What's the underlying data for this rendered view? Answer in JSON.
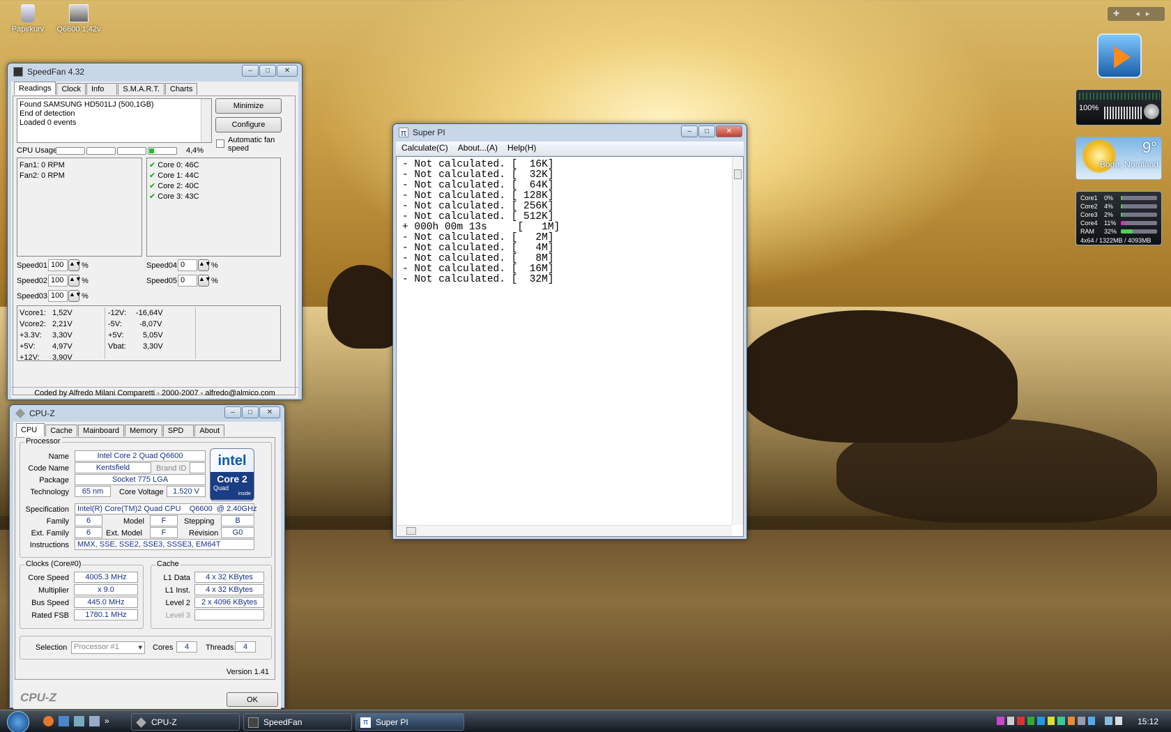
{
  "desktop": {
    "icons": [
      {
        "label": "Papirkurv"
      },
      {
        "label": "Q6600 1,42v"
      }
    ]
  },
  "speedfan": {
    "title": "SpeedFan 4.32",
    "tabs": [
      "Readings",
      "Clock",
      "Info",
      "S.M.A.R.T.",
      "Charts"
    ],
    "log": [
      "Found SAMSUNG HD501LJ (500,1GB)",
      "End of detection",
      "Loaded 0 events"
    ],
    "buttons": {
      "minimize": "Minimize",
      "configure": "Configure"
    },
    "auto_fan": "Automatic fan speed",
    "cpu_usage_label": "CPU Usage",
    "cpu_usage_value": "4,4%",
    "cpu_usage_fraction": 0.044,
    "fans": [
      "Fan1: 0 RPM",
      "Fan2: 0 RPM"
    ],
    "temps": [
      "Core 0: 46C",
      "Core 1: 44C",
      "Core 2: 40C",
      "Core 3: 43C"
    ],
    "speeds": [
      {
        "label": "Speed01:",
        "value": "100"
      },
      {
        "label": "Speed02:",
        "value": "100"
      },
      {
        "label": "Speed03:",
        "value": "100"
      },
      {
        "label": "Speed04:",
        "value": "0"
      },
      {
        "label": "Speed05:",
        "value": "0"
      }
    ],
    "pct": "%",
    "volts": [
      {
        "l": "Vcore1:",
        "v": "1,52V"
      },
      {
        "l": "Vcore2:",
        "v": "2,21V"
      },
      {
        "l": "+3.3V:",
        "v": "3,30V"
      },
      {
        "l": "+5V:",
        "v": "4,97V"
      },
      {
        "l": "+12V:",
        "v": "3,90V"
      },
      {
        "l": "-12V:",
        "v": "-16,64V"
      },
      {
        "l": "-5V:",
        "v": "-8,07V"
      },
      {
        "l": "+5V:",
        "v": "5,05V"
      },
      {
        "l": "Vbat:",
        "v": "3,30V"
      }
    ],
    "footer": "Coded by Alfredo Milani Comparetti - 2000-2007 - alfredo@almico.com"
  },
  "cpuz": {
    "title": "CPU-Z",
    "tabs": [
      "CPU",
      "Cache",
      "Mainboard",
      "Memory",
      "SPD",
      "About"
    ],
    "processor_group": "Processor",
    "name_l": "Name",
    "name": "Intel Core 2 Quad Q6600",
    "code_l": "Code Name",
    "code": "Kentsfield",
    "brand_l": "Brand ID",
    "package_l": "Package",
    "package": "Socket 775 LGA",
    "tech_l": "Technology",
    "tech": "65 nm",
    "cv_l": "Core Voltage",
    "cv": "1.520 V",
    "spec_l": "Specification",
    "spec": "Intel(R) Core(TM)2 Quad CPU    Q6600  @ 2.40GHz",
    "family_l": "Family",
    "family": "6",
    "model_l": "Model",
    "model": "F",
    "stepping_l": "Stepping",
    "stepping": "B",
    "extfam_l": "Ext. Family",
    "extfam": "6",
    "extmod_l": "Ext. Model",
    "extmod": "F",
    "rev_l": "Revision",
    "rev": "G0",
    "instr_l": "Instructions",
    "instr": "MMX, SSE, SSE2, SSE3, SSSE3, EM64T",
    "clocks_group": "Clocks (Core#0)",
    "cs_l": "Core Speed",
    "cs": "4005.3 MHz",
    "mult_l": "Multiplier",
    "mult": "x 9.0",
    "bus_l": "Bus Speed",
    "bus": "445.0 MHz",
    "fsb_l": "Rated FSB",
    "fsb": "1780.1 MHz",
    "cache_group": "Cache",
    "l1d_l": "L1 Data",
    "l1d": "4 x 32 KBytes",
    "l1i_l": "L1 Inst.",
    "l1i": "4 x 32 KBytes",
    "l2_l": "Level 2",
    "l2": "2 x 4096 KBytes",
    "l3_l": "Level 3",
    "sel_l": "Selection",
    "sel": "Processor #1",
    "cores_l": "Cores",
    "cores": "4",
    "threads_l": "Threads",
    "threads": "4",
    "version": "Version 1.41",
    "brand": "CPU-Z",
    "ok": "OK",
    "logo": {
      "intel": "intel",
      "core": "Core 2",
      "quad": "Quad",
      "inside": "inside"
    }
  },
  "superpi": {
    "title": "Super PI",
    "menu": [
      "Calculate(C)",
      "About...(A)",
      "Help(H)"
    ],
    "lines": [
      "- Not calculated. [  16K]",
      "- Not calculated. [  32K]",
      "- Not calculated. [  64K]",
      "- Not calculated. [ 128K]",
      "- Not calculated. [ 256K]",
      "- Not calculated. [ 512K]",
      "+ 000h 00m 13s     [   1M]",
      "- Not calculated. [   2M]",
      "- Not calculated. [   4M]",
      "- Not calculated. [   8M]",
      "- Not calculated. [  16M]",
      "- Not calculated. [  32M]"
    ]
  },
  "gadgets": {
    "volume": "100%",
    "weather_temp": "9°",
    "weather_city": "Bodø, Nordland",
    "meters": [
      {
        "l": "Core1",
        "v": "0%",
        "f": 0.0
      },
      {
        "l": "Core2",
        "v": "4%",
        "f": 0.04
      },
      {
        "l": "Core3",
        "v": "2%",
        "f": 0.02
      },
      {
        "l": "Core4",
        "v": "11%",
        "f": 0.11
      },
      {
        "l": "RAM",
        "v": "32%",
        "f": 0.32
      }
    ],
    "mem_text": "4x64 / 1322MB / 4093MB"
  },
  "taskbar": {
    "items": [
      "CPU-Z",
      "SpeedFan",
      "Super PI"
    ],
    "clock": "15:12"
  },
  "colors": {
    "accent": "#3c5a7a",
    "sea": "#c99e46"
  }
}
